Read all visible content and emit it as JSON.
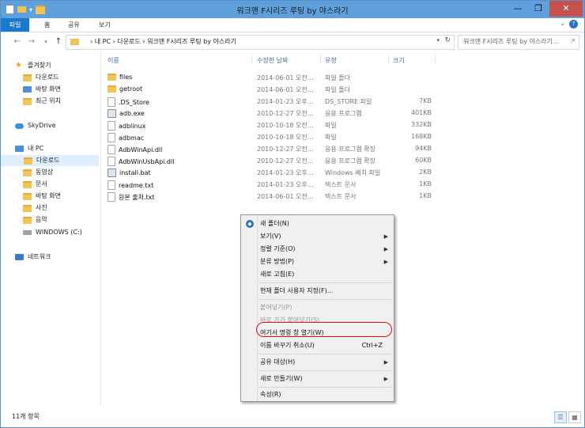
{
  "window": {
    "title": "워크맨 F시리즈 루팅 by 야스라기",
    "controls": [
      "—",
      "❐",
      "✕"
    ]
  },
  "ribbon": {
    "tabs": [
      "파일",
      "홈",
      "공유",
      "보기"
    ]
  },
  "addressbar": {
    "path": "›  내 PC  ›  다운로드  ›  워크맨 F시리즈 루팅 by 야스라기",
    "search_placeholder": "워크맨 F시리즈 루팅 by 야스라기..."
  },
  "nav": {
    "favorites_header": "즐겨찾기",
    "favorites": [
      "다운로드",
      "바탕 화면",
      "최근 위치"
    ],
    "skydrive": "SkyDrive",
    "pc_header": "내 PC",
    "pc_items": [
      "다운로드",
      "동영상",
      "문서",
      "바탕 화면",
      "사진",
      "음악",
      "WINDOWS (C:)"
    ],
    "network": "네트워크"
  },
  "columns": [
    "이름",
    "수정한 날짜",
    "유형",
    "크기"
  ],
  "files": [
    {
      "name": "files",
      "date": "2014-06-01 오전...",
      "type": "파일 폴더",
      "size": "",
      "icon": "folder"
    },
    {
      "name": "getroot",
      "date": "2014-06-01 오전...",
      "type": "파일 폴더",
      "size": "",
      "icon": "folder"
    },
    {
      "name": ".DS_Store",
      "date": "2014-01-23 오후...",
      "type": "DS_STORE 파일",
      "size": "7KB",
      "icon": "file"
    },
    {
      "name": "adb.exe",
      "date": "2010-12-27 오전...",
      "type": "응용 프로그램",
      "size": "401KB",
      "icon": "exe"
    },
    {
      "name": "adblinux",
      "date": "2010-10-18 오전...",
      "type": "파일",
      "size": "332KB",
      "icon": "file"
    },
    {
      "name": "adbmac",
      "date": "2010-10-18 오전...",
      "type": "파일",
      "size": "168KB",
      "icon": "file"
    },
    {
      "name": "AdbWinApi.dll",
      "date": "2010-12-27 오전...",
      "type": "응용 프로그램 확장",
      "size": "94KB",
      "icon": "file"
    },
    {
      "name": "AdbWinUsbApi.dll",
      "date": "2010-12-27 오전...",
      "type": "응용 프로그램 확장",
      "size": "60KB",
      "icon": "file"
    },
    {
      "name": "install.bat",
      "date": "2014-01-23 오후...",
      "type": "Windows 배치 파일",
      "size": "2KB",
      "icon": "exe"
    },
    {
      "name": "readme.txt",
      "date": "2014-01-23 오후...",
      "type": "텍스트 문서",
      "size": "1KB",
      "icon": "file"
    },
    {
      "name": "원본 출처.txt",
      "date": "2014-06-01 오전...",
      "type": "텍스트 문서",
      "size": "1KB",
      "icon": "file"
    }
  ],
  "status": {
    "count": "11개 항목"
  },
  "context_menu": {
    "items": [
      {
        "label": "새 폴더(N)",
        "disabled": false,
        "submenu": false,
        "shortcut": ""
      },
      {
        "label": "보기(V)",
        "disabled": false,
        "submenu": true,
        "shortcut": ""
      },
      {
        "label": "정렬 기준(O)",
        "disabled": false,
        "submenu": true,
        "shortcut": ""
      },
      {
        "label": "분류 방법(P)",
        "disabled": false,
        "submenu": true,
        "shortcut": ""
      },
      {
        "label": "새로 고침(E)",
        "disabled": false,
        "submenu": false,
        "shortcut": ""
      },
      {
        "label": "현재 폴더 사용자 지정(F)...",
        "disabled": false,
        "submenu": false,
        "shortcut": ""
      },
      {
        "label": "붙여넣기(P)",
        "disabled": true,
        "submenu": false,
        "shortcut": ""
      },
      {
        "label": "바로 가기 붙여넣기(S)",
        "disabled": true,
        "submenu": false,
        "shortcut": ""
      },
      {
        "label": "여기서 명령 창 열기(W)",
        "disabled": false,
        "submenu": false,
        "shortcut": ""
      },
      {
        "label": "이름 바꾸기 취소(U)",
        "disabled": false,
        "submenu": false,
        "shortcut": "Ctrl+Z"
      },
      {
        "label": "공유 대상(H)",
        "disabled": false,
        "submenu": true,
        "shortcut": ""
      },
      {
        "label": "새로 만들기(W)",
        "disabled": false,
        "submenu": true,
        "shortcut": ""
      },
      {
        "label": "속성(R)",
        "disabled": false,
        "submenu": false,
        "shortcut": ""
      }
    ]
  },
  "colors": {
    "titlebar": "#5fa0dc",
    "file_tab": "#1979ca",
    "close_button": "#c7504c",
    "annotation": "#e01010"
  }
}
